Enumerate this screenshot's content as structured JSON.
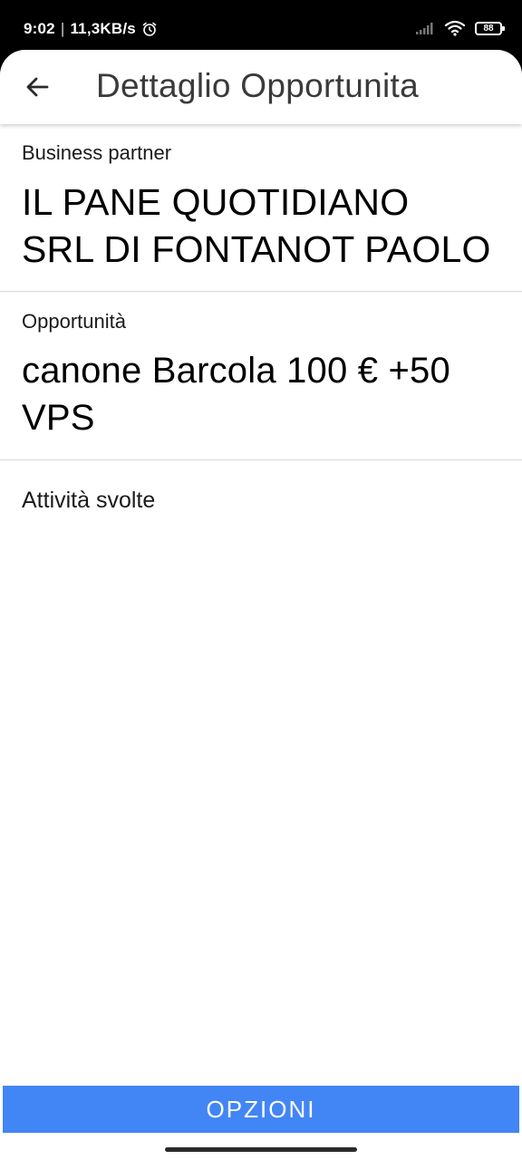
{
  "status_bar": {
    "time": "9:02",
    "separator": "|",
    "net_speed": "11,3KB/s",
    "battery_level": "88",
    "icons": [
      "alarm-icon",
      "signal-icon",
      "wifi-icon",
      "battery-icon"
    ]
  },
  "app_bar": {
    "back_icon": "arrow-left-icon",
    "title": "Dettaglio Opportunita"
  },
  "business_partner": {
    "label": "Business partner",
    "value_line1": "IL PANE QUOTIDIANO",
    "value_line2": "SRL DI FONTANOT PAOLO"
  },
  "opportunity": {
    "label": "Opportunità",
    "value_line1": "canone Barcola 100 € +50",
    "value_line2": "VPS"
  },
  "activities": {
    "label": "Attività svolte"
  },
  "footer": {
    "options_label": "OPZIONI"
  },
  "colors": {
    "primary_button": "#4285f4",
    "title_text": "#3a3a3a",
    "divider": "#d8d8d8"
  }
}
